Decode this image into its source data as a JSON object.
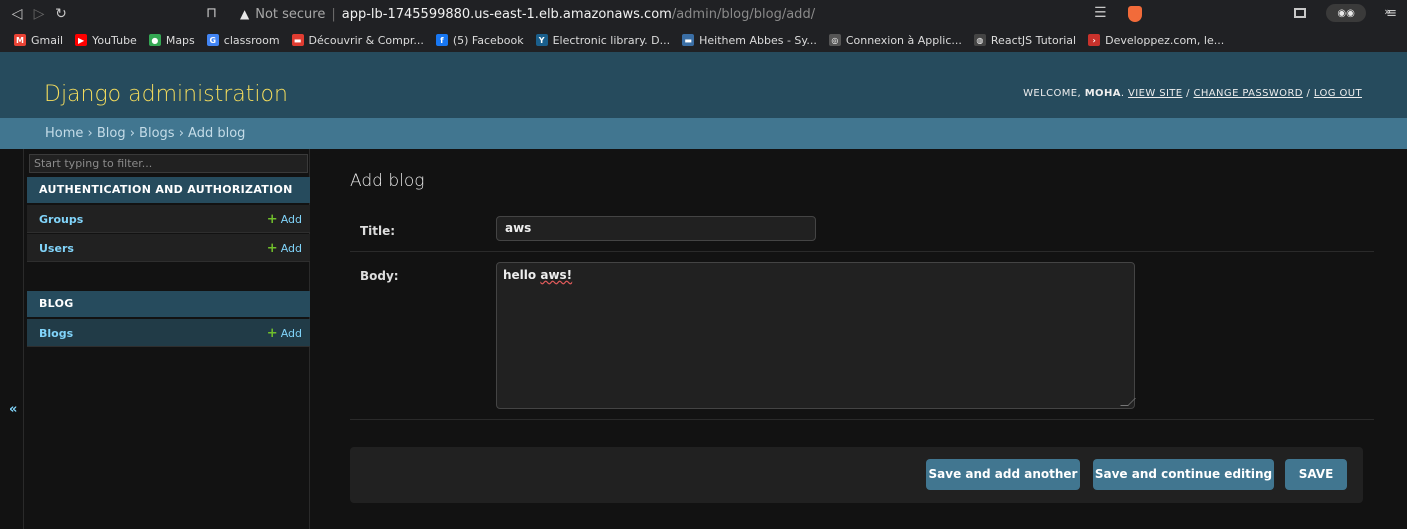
{
  "browser": {
    "url_warning": "Not secure",
    "url_host": "app-lb-1745599880.us-east-1.elb.amazonaws.com",
    "url_path": "/admin/blog/blog/add/",
    "bookmarks": [
      {
        "label": "Gmail",
        "icon": "gmail-icon",
        "color": "#ea4335",
        "glyph": "M"
      },
      {
        "label": "YouTube",
        "icon": "youtube-icon",
        "color": "#ff0000",
        "glyph": "▶"
      },
      {
        "label": "Maps",
        "icon": "maps-icon",
        "color": "#34a853",
        "glyph": "●"
      },
      {
        "label": "classroom",
        "icon": "google-icon",
        "color": "#4285f4",
        "glyph": "G"
      },
      {
        "label": "Découvrir & Compr...",
        "icon": "site-icon",
        "color": "#e03c31",
        "glyph": "▬"
      },
      {
        "label": "(5) Facebook",
        "icon": "facebook-icon",
        "color": "#1877f2",
        "glyph": "f"
      },
      {
        "label": "Electronic library. D...",
        "icon": "library-icon",
        "color": "#1a5f8c",
        "glyph": "Y"
      },
      {
        "label": "Heithem Abbes - Sy...",
        "icon": "site-icon",
        "color": "#3a6ea5",
        "glyph": "▬"
      },
      {
        "label": "Connexion à Applic...",
        "icon": "globe-icon",
        "color": "#555555",
        "glyph": "◎"
      },
      {
        "label": "ReactJS Tutorial",
        "icon": "react-icon",
        "color": "#444444",
        "glyph": "◍"
      },
      {
        "label": "Developpez.com, le...",
        "icon": "developpez-icon",
        "color": "#c9322c",
        "glyph": "›"
      }
    ],
    "bookmarks_more": "»"
  },
  "header": {
    "site_name": "Django administration",
    "welcome": "WELCOME,",
    "username": "MOHA",
    "view_site": "VIEW SITE",
    "change_password": "CHANGE PASSWORD",
    "log_out": "LOG OUT",
    "separator": "/"
  },
  "breadcrumbs": "Home › Blog › Blogs › Add blog",
  "sidebar": {
    "filter_placeholder": "Start typing to filter...",
    "collapse_label": "«",
    "modules": [
      {
        "title": "AUTHENTICATION AND AUTHORIZATION",
        "models": [
          {
            "name": "Groups",
            "add": "Add"
          },
          {
            "name": "Users",
            "add": "Add"
          }
        ]
      },
      {
        "title": "BLOG",
        "models": [
          {
            "name": "Blogs",
            "add": "Add"
          }
        ]
      }
    ],
    "add_plus": "+"
  },
  "form": {
    "title": "Add blog",
    "title_label": "Title:",
    "title_value": "aws",
    "body_label": "Body:",
    "body_value_prefix": "hello ",
    "body_value_word": "aws!"
  },
  "buttons": {
    "save_add_another": "Save and add another",
    "save_continue": "Save and continue editing",
    "save": "SAVE"
  },
  "colors": {
    "header_bg": "#264b5d",
    "breadcrumb_bg": "#417690",
    "site_name": "#f5dd5d",
    "link": "#81d4fa",
    "add_plus": "#70bf2b",
    "button_bg": "#417690",
    "page_bg": "#121212"
  }
}
